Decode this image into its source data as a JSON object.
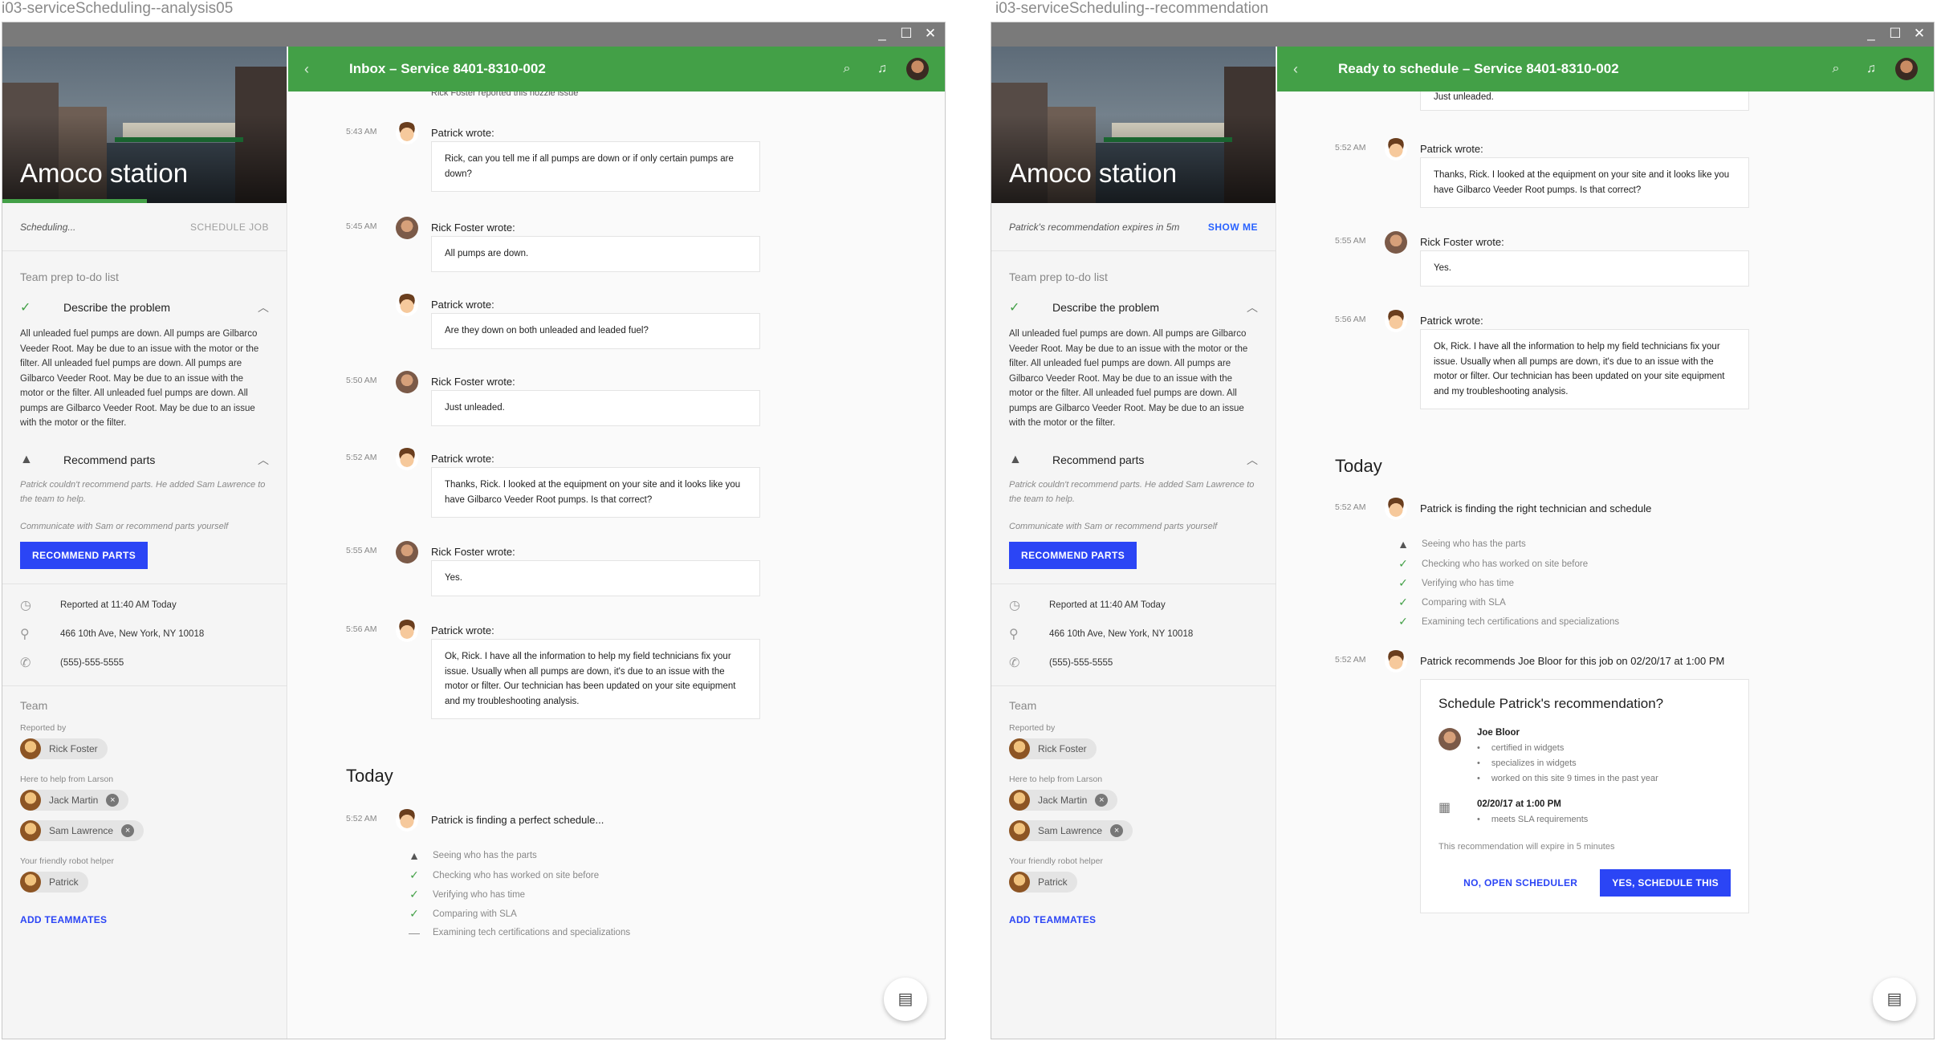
{
  "screens": [
    {
      "frame_label": "i03-serviceScheduling--analysis05",
      "sidebar": {
        "station_name": "Amoco station",
        "status_left": "Scheduling...",
        "status_right": "SCHEDULE JOB",
        "todo_header": "Team prep to-do list",
        "todo_describe": "Describe the problem",
        "problem_text": "All unleaded fuel pumps are down. All pumps are Gilbarco Veeder Root. May be due to an issue with the motor or the filter. All unleaded fuel pumps are down. All pumps are Gilbarco Veeder Root. May be due to an issue with the motor or the filter. All unleaded fuel pumps are down. All pumps are Gilbarco Veeder Root. May be due to an issue with the motor or the filter.",
        "todo_recommend": "Recommend parts",
        "recommend_note": "Patrick couldn't recommend parts. He added Sam Lawrence to the team to help.",
        "communicate_note": "Communicate with Sam or recommend parts yourself",
        "recommend_btn": "RECOMMEND PARTS",
        "reported": "Reported at 11:40 AM Today",
        "address": "466 10th Ave, New York, NY 10018",
        "phone": "(555)-555-5555",
        "team_header": "Team",
        "reported_by_label": "Reported by",
        "reporter": "Rick Foster",
        "help_label": "Here to help from Larson",
        "helper1": "Jack Martin",
        "helper2": "Sam Lawrence",
        "robot_label": "Your friendly robot helper",
        "robot": "Patrick",
        "add_teammates": "ADD TEAMMATES"
      },
      "appbar": {
        "title": "Inbox – Service 8401-8310-002"
      },
      "feed": {
        "top_clip": "Rick Foster reported this nozzle issue",
        "messages": [
          {
            "time": "5:43 AM",
            "who": "Patrick wrote:",
            "text": "Rick, can you tell me if all pumps are down or if only certain pumps are down?"
          },
          {
            "time": "5:45 AM",
            "who": "Rick Foster wrote:",
            "text": "All pumps are down."
          },
          {
            "time": "",
            "who": "Patrick wrote:",
            "text": "Are they down on both unleaded and leaded fuel?"
          },
          {
            "time": "5:50 AM",
            "who": "Rick Foster wrote:",
            "text": "Just unleaded."
          },
          {
            "time": "5:52 AM",
            "who": "Patrick wrote:",
            "text": "Thanks, Rick. I looked at the equipment on your site and it looks like you have Gilbarco Veeder Root pumps. Is that correct?"
          },
          {
            "time": "5:55 AM",
            "who": "Rick Foster wrote:",
            "text": "Yes."
          },
          {
            "time": "5:56 AM",
            "who": "Patrick wrote:",
            "text": "Ok, Rick. I have all the information to help my field technicians fix your issue. Usually when all pumps are down, it's due to an issue with the motor or filter. Our technician has been updated on your site equipment and my troubleshooting analysis."
          }
        ],
        "today": "Today",
        "status_time": "5:52 AM",
        "status_text": "Patrick is finding a perfect schedule...",
        "steps": [
          {
            "icon": "warning-icon",
            "text": "Seeing who has the parts"
          },
          {
            "icon": "check-icon",
            "text": "Checking who has worked on site before"
          },
          {
            "icon": "check-icon",
            "text": "Verifying who has time"
          },
          {
            "icon": "check-icon",
            "text": "Comparing with SLA"
          },
          {
            "icon": "dash-icon",
            "text": "Examining tech certifications and specializations"
          }
        ]
      }
    },
    {
      "frame_label": "i03-serviceScheduling--recommendation",
      "sidebar": {
        "station_name": "Amoco station",
        "status_left": "Patrick's recommendation expires in 5m",
        "status_right": "SHOW ME",
        "todo_header": "Team prep to-do list",
        "todo_describe": "Describe the problem",
        "problem_text": "All unleaded fuel pumps are down. All pumps are Gilbarco Veeder Root. May be due to an issue with the motor or the filter. All unleaded fuel pumps are down. All pumps are Gilbarco Veeder Root. May be due to an issue with the motor or the filter. All unleaded fuel pumps are down. All pumps are Gilbarco Veeder Root. May be due to an issue with the motor or the filter.",
        "todo_recommend": "Recommend parts",
        "recommend_note": "Patrick couldn't recommend parts. He added Sam Lawrence to the team to help.",
        "communicate_note": "Communicate with Sam or recommend parts yourself",
        "recommend_btn": "RECOMMEND PARTS",
        "reported": "Reported at 11:40 AM Today",
        "address": "466 10th Ave, New York, NY 10018",
        "phone": "(555)-555-5555",
        "team_header": "Team",
        "reported_by_label": "Reported by",
        "reporter": "Rick Foster",
        "help_label": "Here to help from Larson",
        "helper1": "Jack Martin",
        "helper2": "Sam Lawrence",
        "robot_label": "Your friendly robot helper",
        "robot": "Patrick",
        "add_teammates": "ADD TEAMMATES"
      },
      "appbar": {
        "title": "Ready to schedule – Service 8401-8310-002"
      },
      "feed": {
        "top_clip": "Just unleaded.",
        "messages": [
          {
            "time": "5:52 AM",
            "who": "Patrick wrote:",
            "text": "Thanks, Rick. I looked at the equipment on your site and it looks like you have Gilbarco Veeder Root pumps. Is that correct?"
          },
          {
            "time": "5:55 AM",
            "who": "Rick Foster wrote:",
            "text": "Yes."
          },
          {
            "time": "5:56 AM",
            "who": "Patrick wrote:",
            "text": "Ok, Rick. I have all the information to help my field technicians fix your issue. Usually when all pumps are down, it's due to an issue with the motor or filter. Our technician has been updated on your site equipment and my troubleshooting analysis."
          }
        ],
        "today": "Today",
        "status_time": "5:52 AM",
        "status_text": "Patrick is finding the right technician and schedule",
        "steps": [
          {
            "icon": "warning-icon",
            "text": "Seeing who has the parts"
          },
          {
            "icon": "check-icon",
            "text": "Checking who has worked on site before"
          },
          {
            "icon": "check-icon",
            "text": "Verifying who has time"
          },
          {
            "icon": "check-icon",
            "text": "Comparing with SLA"
          },
          {
            "icon": "check-icon",
            "text": "Examining tech certifications and specializations"
          }
        ],
        "rec_time": "5:52 AM",
        "rec_text": "Patrick recommends Joe Bloor for this job on 02/20/17 at 1:00 PM",
        "rec_card": {
          "title": "Schedule Patrick's recommendation?",
          "tech": "Joe Bloor",
          "tech_points": [
            "certified in widgets",
            "specializes in widgets",
            "worked on this site 9 times in the past year"
          ],
          "date": "02/20/17 at 1:00 PM",
          "date_points": [
            "meets SLA requirements"
          ],
          "expires": "This recommendation will expire in 5 minutes",
          "btn_no": "NO, OPEN SCHEDULER",
          "btn_yes": "YES, SCHEDULE THIS"
        }
      }
    }
  ],
  "colors": {
    "appbar": "#43a047",
    "primary_button": "#2b45f5",
    "check": "#43a047"
  }
}
